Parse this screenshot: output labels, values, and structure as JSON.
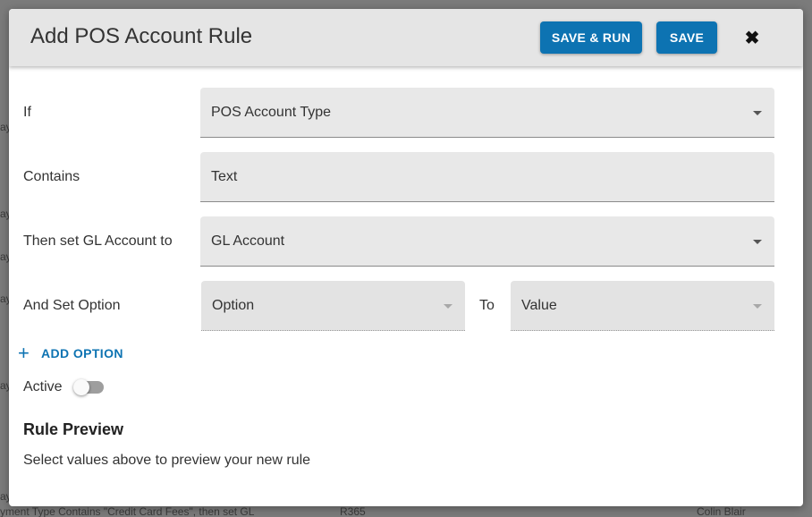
{
  "background": {
    "left_fragments": [
      "ay",
      "ay",
      "ay",
      "ay",
      "ay",
      "ay"
    ],
    "bottom_row": {
      "description": "yment Type Contains \"Credit Card Fees\", then set GL",
      "code": "R365",
      "user": "Colin Blair"
    }
  },
  "dialog": {
    "title": "Add POS Account Rule",
    "save_run_label": "SAVE & RUN",
    "save_label": "SAVE",
    "close_icon": "✖"
  },
  "form": {
    "if_label": "If",
    "if_value": "POS Account Type",
    "contains_label": "Contains",
    "contains_placeholder": "Text",
    "then_label": "Then set GL Account to",
    "then_value": "GL Account",
    "option_label": "And Set Option",
    "option_value": "Option",
    "to_label": "To",
    "value_value": "Value",
    "add_option_icon": "+",
    "add_option_label": "ADD OPTION",
    "active_label": "Active",
    "active_on": false
  },
  "preview": {
    "title": "Rule Preview",
    "text": "Select values above to preview your new rule"
  },
  "colors": {
    "accent": "#0d73b2",
    "header_bg": "#e5e5e5",
    "field_bg": "#e8e8e8"
  }
}
